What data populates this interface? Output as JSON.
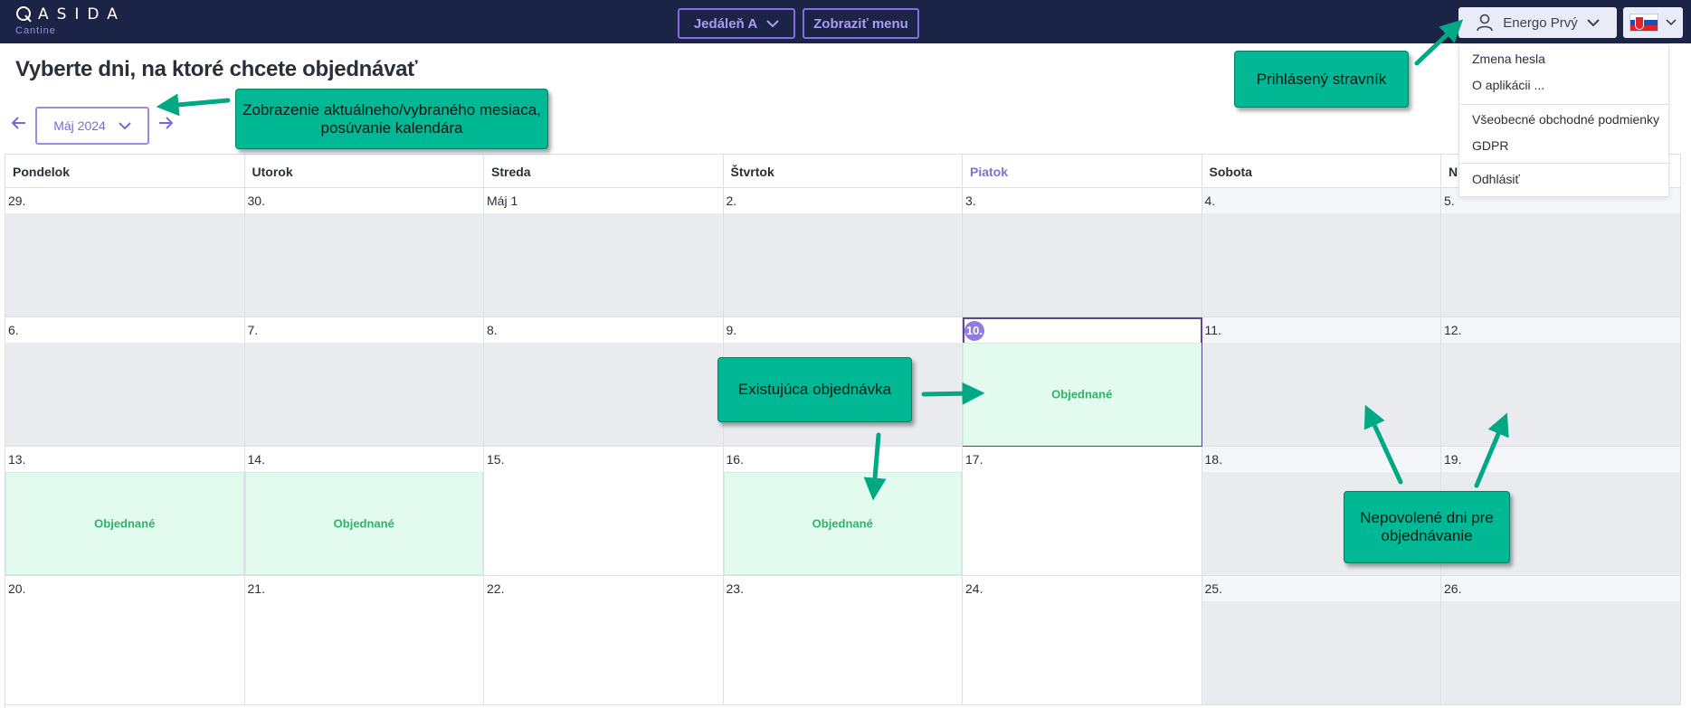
{
  "app": {
    "logo_text": "ASIDA",
    "logo_sub": "Cantine"
  },
  "header": {
    "canteen_label": "Jedáleň A",
    "menu_label": "Zobraziť menu",
    "user_name": "Energo Prvý",
    "language_flag": "sk-flag-icon"
  },
  "user_menu": {
    "items": [
      "Zmena hesla",
      "O aplikácii ...",
      "Všeobecné obchodné podmienky",
      "GDPR",
      "Odhlásiť"
    ]
  },
  "page": {
    "title": "Vyberte dni, na ktoré chcete objednávať",
    "month_label": "Máj 2024"
  },
  "calendar": {
    "weekdays": [
      "Pondelok",
      "Utorok",
      "Streda",
      "Štvrtok",
      "Piatok",
      "Sobota",
      "N"
    ],
    "today_weekday_index": 4,
    "ordered_label": "Objednané",
    "weeks": [
      [
        {
          "label": "29.",
          "state": "disabled"
        },
        {
          "label": "30.",
          "state": "disabled"
        },
        {
          "label": "Máj 1",
          "state": "disabled"
        },
        {
          "label": "2.",
          "state": "disabled"
        },
        {
          "label": "3.",
          "state": "disabled"
        },
        {
          "label": "4.",
          "state": "disabled",
          "weekend": true
        },
        {
          "label": "5.",
          "state": "disabled",
          "weekend": true
        }
      ],
      [
        {
          "label": "6.",
          "state": "disabled"
        },
        {
          "label": "7.",
          "state": "disabled"
        },
        {
          "label": "8.",
          "state": "disabled"
        },
        {
          "label": "9.",
          "state": "disabled"
        },
        {
          "label": "10.",
          "state": "ordered",
          "today": true
        },
        {
          "label": "11.",
          "state": "disabled",
          "weekend": true
        },
        {
          "label": "12.",
          "state": "disabled",
          "weekend": true
        }
      ],
      [
        {
          "label": "13.",
          "state": "ordered"
        },
        {
          "label": "14.",
          "state": "ordered"
        },
        {
          "label": "15.",
          "state": "open"
        },
        {
          "label": "16.",
          "state": "ordered"
        },
        {
          "label": "17.",
          "state": "open"
        },
        {
          "label": "18.",
          "state": "disabled",
          "weekend": true
        },
        {
          "label": "19.",
          "state": "disabled",
          "weekend": true
        }
      ],
      [
        {
          "label": "20.",
          "state": "open"
        },
        {
          "label": "21.",
          "state": "open"
        },
        {
          "label": "22.",
          "state": "open"
        },
        {
          "label": "23.",
          "state": "open"
        },
        {
          "label": "24.",
          "state": "open"
        },
        {
          "label": "25.",
          "state": "disabled",
          "weekend": true
        },
        {
          "label": "26.",
          "state": "disabled",
          "weekend": true
        }
      ]
    ]
  },
  "annotations": {
    "month_nav": "Zobrazenie aktuálneho/vybraného mesiaca, posúvanie kalendára",
    "logged_user": "Prihlásený stravník",
    "existing_order": "Existujúca objednávka",
    "disabled_days": "Nepovolené dni pre objednávanie"
  },
  "colors": {
    "topbar": "#1b2347",
    "accent": "#7f6fe0",
    "ordered_bg": "#e3fbee",
    "ordered_text": "#2fb36b",
    "disabled_bg": "#e9ebef",
    "callout": "#00b894"
  }
}
